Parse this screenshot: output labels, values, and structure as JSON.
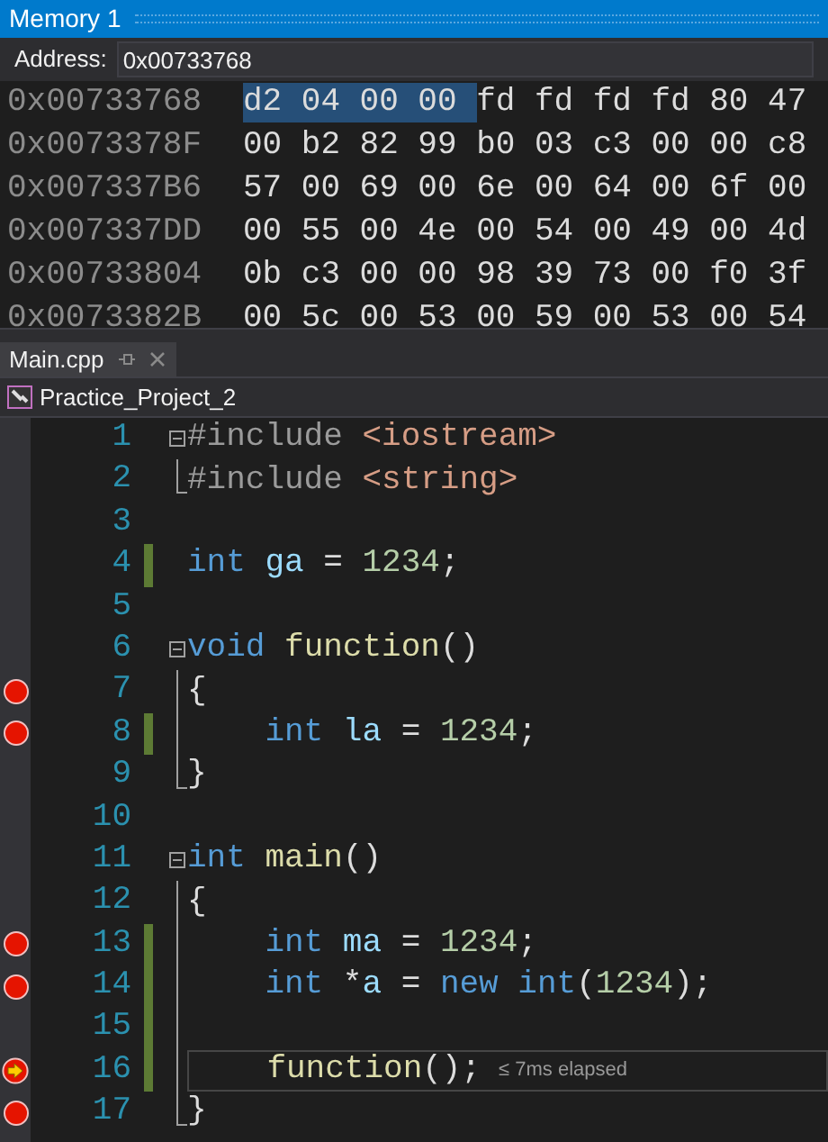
{
  "memory_window": {
    "title": "Memory 1",
    "address_label": "Address:",
    "address_value": "0x00733768",
    "rows": [
      {
        "address": "0x00733768",
        "bytes": [
          {
            "text": "d2",
            "selected": true
          },
          {
            "text": "04",
            "selected": true
          },
          {
            "text": "00",
            "selected": true
          },
          {
            "text": "00",
            "selected": true
          },
          {
            "text": "fd",
            "selected": false
          },
          {
            "text": "fd",
            "selected": false
          },
          {
            "text": "fd",
            "selected": false
          },
          {
            "text": "fd",
            "selected": false
          },
          {
            "text": "80",
            "selected": false
          },
          {
            "text": "47",
            "selected": false
          }
        ]
      },
      {
        "address": "0x0073378F",
        "bytes": [
          {
            "text": "00",
            "selected": false
          },
          {
            "text": "b2",
            "selected": false
          },
          {
            "text": "82",
            "selected": false
          },
          {
            "text": "99",
            "selected": false
          },
          {
            "text": "b0",
            "selected": false
          },
          {
            "text": "03",
            "selected": false
          },
          {
            "text": "c3",
            "selected": false
          },
          {
            "text": "00",
            "selected": false
          },
          {
            "text": "00",
            "selected": false
          },
          {
            "text": "c8",
            "selected": false
          }
        ]
      },
      {
        "address": "0x007337B6",
        "bytes": [
          {
            "text": "57",
            "selected": false
          },
          {
            "text": "00",
            "selected": false
          },
          {
            "text": "69",
            "selected": false
          },
          {
            "text": "00",
            "selected": false
          },
          {
            "text": "6e",
            "selected": false
          },
          {
            "text": "00",
            "selected": false
          },
          {
            "text": "64",
            "selected": false
          },
          {
            "text": "00",
            "selected": false
          },
          {
            "text": "6f",
            "selected": false
          },
          {
            "text": "00",
            "selected": false
          }
        ]
      },
      {
        "address": "0x007337DD",
        "bytes": [
          {
            "text": "00",
            "selected": false
          },
          {
            "text": "55",
            "selected": false
          },
          {
            "text": "00",
            "selected": false
          },
          {
            "text": "4e",
            "selected": false
          },
          {
            "text": "00",
            "selected": false
          },
          {
            "text": "54",
            "selected": false
          },
          {
            "text": "00",
            "selected": false
          },
          {
            "text": "49",
            "selected": false
          },
          {
            "text": "00",
            "selected": false
          },
          {
            "text": "4d",
            "selected": false
          }
        ]
      },
      {
        "address": "0x00733804",
        "bytes": [
          {
            "text": "0b",
            "selected": false
          },
          {
            "text": "c3",
            "selected": false
          },
          {
            "text": "00",
            "selected": false
          },
          {
            "text": "00",
            "selected": false
          },
          {
            "text": "98",
            "selected": false
          },
          {
            "text": "39",
            "selected": false
          },
          {
            "text": "73",
            "selected": false
          },
          {
            "text": "00",
            "selected": false
          },
          {
            "text": "f0",
            "selected": false
          },
          {
            "text": "3f",
            "selected": false
          }
        ]
      },
      {
        "address": "0x0073382B",
        "bytes": [
          {
            "text": "00",
            "selected": false
          },
          {
            "text": "5c",
            "selected": false
          },
          {
            "text": "00",
            "selected": false
          },
          {
            "text": "53",
            "selected": false
          },
          {
            "text": "00",
            "selected": false
          },
          {
            "text": "59",
            "selected": false
          },
          {
            "text": "00",
            "selected": false
          },
          {
            "text": "53",
            "selected": false
          },
          {
            "text": "00",
            "selected": false
          },
          {
            "text": "54",
            "selected": false
          }
        ]
      }
    ]
  },
  "editor": {
    "tabs": [
      {
        "label": "Main.cpp",
        "selected": true
      }
    ],
    "project": "Practice_Project_2",
    "lines": [
      {
        "number": "1",
        "kind": "opener",
        "breakpoint": false,
        "current_statement": false,
        "changed": false,
        "current": false,
        "tokens": [
          {
            "kind": "preproc",
            "text": "#include "
          },
          {
            "kind": "path",
            "text": "<iostream>"
          }
        ]
      },
      {
        "number": "2",
        "kind": "closer",
        "breakpoint": false,
        "current_statement": false,
        "changed": false,
        "current": false,
        "tokens": [
          {
            "kind": "preproc",
            "text": "#include "
          },
          {
            "kind": "path",
            "text": "<string>"
          }
        ]
      },
      {
        "number": "3",
        "kind": "plain",
        "breakpoint": false,
        "current_statement": false,
        "changed": false,
        "current": false
      },
      {
        "number": "4",
        "kind": "plain",
        "breakpoint": false,
        "current_statement": false,
        "changed": true,
        "current": false,
        "tokens": [
          {
            "kind": "keyword",
            "text": "int "
          },
          {
            "kind": "ident",
            "text": "ga"
          },
          {
            "kind": "punct",
            "text": " = "
          },
          {
            "kind": "number",
            "text": "1234"
          },
          {
            "kind": "punct",
            "text": ";"
          }
        ]
      },
      {
        "number": "5",
        "kind": "plain",
        "breakpoint": false,
        "current_statement": false,
        "changed": false,
        "current": false
      },
      {
        "number": "6",
        "kind": "opener",
        "breakpoint": false,
        "current_statement": false,
        "changed": false,
        "current": false,
        "tokens": [
          {
            "kind": "keyword",
            "text": "void "
          },
          {
            "kind": "func",
            "text": "function"
          },
          {
            "kind": "punct",
            "text": "()"
          }
        ]
      },
      {
        "number": "7",
        "kind": "inner",
        "breakpoint": true,
        "current_statement": false,
        "changed": false,
        "current": false,
        "tokens": [
          {
            "kind": "punct",
            "text": "{"
          }
        ]
      },
      {
        "number": "8",
        "kind": "inner",
        "breakpoint": true,
        "current_statement": false,
        "changed": true,
        "current": false,
        "tokens": [
          {
            "kind": "keyword",
            "text": "    int "
          },
          {
            "kind": "ident",
            "text": "la"
          },
          {
            "kind": "punct",
            "text": " = "
          },
          {
            "kind": "number",
            "text": "1234"
          },
          {
            "kind": "punct",
            "text": ";"
          }
        ]
      },
      {
        "number": "9",
        "kind": "closer",
        "breakpoint": false,
        "current_statement": false,
        "changed": false,
        "current": false,
        "tokens": [
          {
            "kind": "punct",
            "text": "}"
          }
        ]
      },
      {
        "number": "10",
        "kind": "plain",
        "breakpoint": false,
        "current_statement": false,
        "changed": false,
        "current": false
      },
      {
        "number": "11",
        "kind": "opener",
        "breakpoint": false,
        "current_statement": false,
        "changed": false,
        "current": false,
        "tokens": [
          {
            "kind": "keyword",
            "text": "int "
          },
          {
            "kind": "func",
            "text": "main"
          },
          {
            "kind": "punct",
            "text": "()"
          }
        ]
      },
      {
        "number": "12",
        "kind": "inner",
        "breakpoint": false,
        "current_statement": false,
        "changed": false,
        "current": false,
        "tokens": [
          {
            "kind": "punct",
            "text": "{"
          }
        ]
      },
      {
        "number": "13",
        "kind": "inner",
        "breakpoint": true,
        "current_statement": false,
        "changed": true,
        "current": false,
        "tokens": [
          {
            "kind": "keyword",
            "text": "    int "
          },
          {
            "kind": "ident",
            "text": "ma"
          },
          {
            "kind": "punct",
            "text": " = "
          },
          {
            "kind": "number",
            "text": "1234"
          },
          {
            "kind": "punct",
            "text": ";"
          }
        ]
      },
      {
        "number": "14",
        "kind": "inner",
        "breakpoint": true,
        "current_statement": false,
        "changed": true,
        "current": false,
        "tokens": [
          {
            "kind": "keyword",
            "text": "    int "
          },
          {
            "kind": "punct",
            "text": "*"
          },
          {
            "kind": "ident",
            "text": "a"
          },
          {
            "kind": "punct",
            "text": " = "
          },
          {
            "kind": "keyword",
            "text": "new int"
          },
          {
            "kind": "punct",
            "text": "("
          },
          {
            "kind": "number",
            "text": "1234"
          },
          {
            "kind": "punct",
            "text": ");"
          }
        ]
      },
      {
        "number": "15",
        "kind": "inner",
        "breakpoint": false,
        "current_statement": false,
        "changed": true,
        "current": false
      },
      {
        "number": "16",
        "kind": "inner",
        "breakpoint": true,
        "current_statement": true,
        "changed": true,
        "current": true,
        "elapsed": "≤ 7ms elapsed",
        "tokens": [
          {
            "kind": "func",
            "text": "    function"
          },
          {
            "kind": "punct",
            "text": "();"
          }
        ]
      },
      {
        "number": "17",
        "kind": "closer",
        "breakpoint": true,
        "current_statement": false,
        "changed": false,
        "current": false,
        "tokens": [
          {
            "kind": "punct",
            "text": "}"
          }
        ]
      }
    ]
  }
}
